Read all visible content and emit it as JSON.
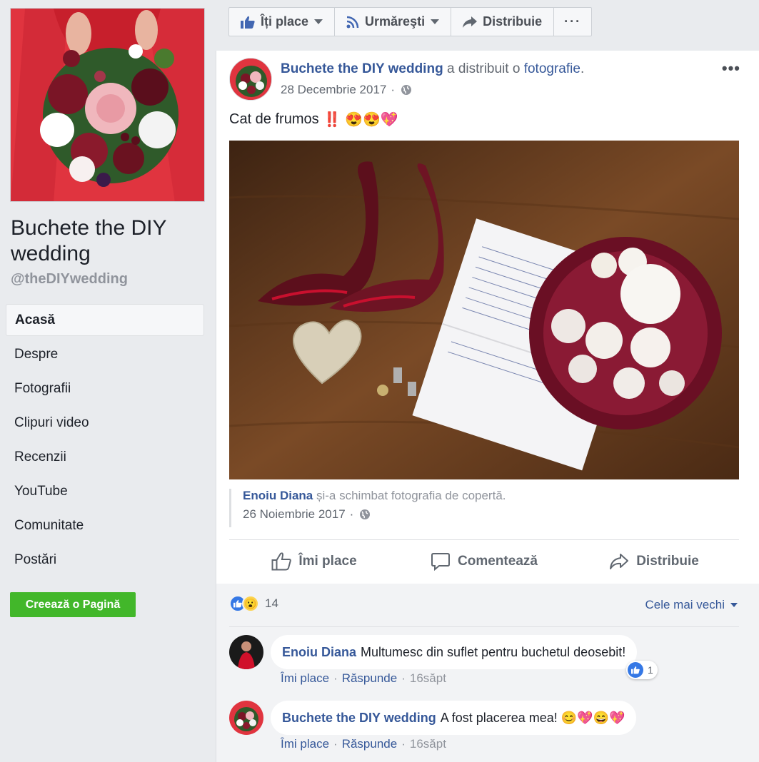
{
  "sidebar": {
    "page_name": "Buchete the DIY wedding",
    "handle": "@theDIYwedding",
    "nav": [
      {
        "label": "Acasă",
        "active": true
      },
      {
        "label": "Despre"
      },
      {
        "label": "Fotografii"
      },
      {
        "label": "Clipuri video"
      },
      {
        "label": "Recenzii"
      },
      {
        "label": "YouTube"
      },
      {
        "label": "Comunitate"
      },
      {
        "label": "Postări"
      }
    ],
    "create_page": "Creează o Pagină"
  },
  "toolbar": {
    "like": "Îți place",
    "follow": "Urmăreşti",
    "share": "Distribuie",
    "more": "···"
  },
  "post": {
    "author": "Buchete the DIY wedding",
    "verb": "a distribuit o",
    "object": "fotografie",
    "period": ".",
    "date": "28 Decembrie 2017",
    "date_sep": "·",
    "more": "•••",
    "text": "Cat de frumos",
    "text_emoji": "‼️ 😍😍💖",
    "shared": {
      "author": "Enoiu Diana",
      "action": "și-a schimbat fotografia de copertă.",
      "date": "26 Noiembrie 2017",
      "date_sep": "·"
    },
    "actions": {
      "like": "Îmi place",
      "comment": "Comentează",
      "share": "Distribuie"
    }
  },
  "reactions": {
    "count": "14",
    "sort_label": "Cele mai vechi"
  },
  "comments": [
    {
      "author": "Enoiu Diana",
      "text": "Multumesc din suflet pentru buchetul deosebit!",
      "like": "Îmi place",
      "reply": "Răspunde",
      "time": "16săpt",
      "sep": "·",
      "reaction_count": "1"
    },
    {
      "author": "Buchete the DIY wedding",
      "text": "A fost placerea mea! 😊💖😄💖",
      "like": "Îmi place",
      "reply": "Răspunde",
      "time": "16săpt",
      "sep": "·"
    }
  ],
  "colors": {
    "link_blue": "#365899",
    "green_button": "#42b72a",
    "like_blue": "#3578e5"
  }
}
